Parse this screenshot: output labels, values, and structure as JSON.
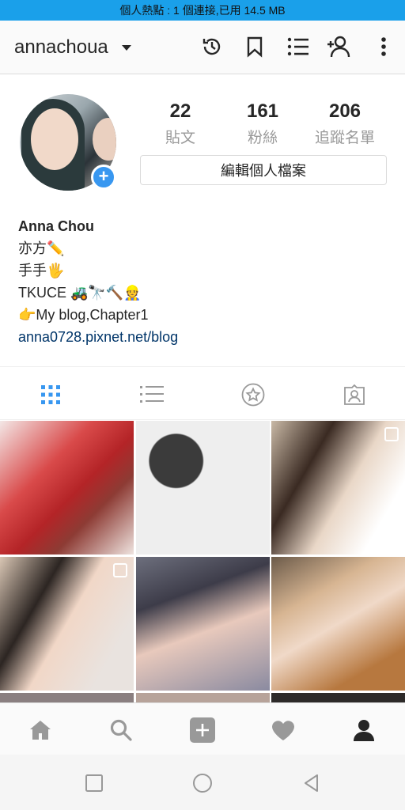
{
  "status_bar": {
    "text": "個人熱點 : 1 個連接,已用 14.5 MB"
  },
  "header": {
    "username": "annachoua"
  },
  "stats": [
    {
      "value": "22",
      "label": "貼文"
    },
    {
      "value": "161",
      "label": "粉絲"
    },
    {
      "value": "206",
      "label": "追蹤名單"
    }
  ],
  "edit_profile_label": "編輯個人檔案",
  "bio": {
    "name": "Anna Chou",
    "lines": [
      "亦方✏️",
      "手手🖐",
      "TKUCE 🚜🔭🔨👷",
      "👉My blog,Chapter1"
    ],
    "link": "anna0728.pixnet.net/blog"
  },
  "colors": {
    "accent": "#3897f0",
    "status_bar": "#1aa0ea",
    "link": "#003569",
    "muted": "#999999"
  },
  "grid": [
    {
      "bg": "linear-gradient(135deg,#f3e7e6 0%,#d94a4a 35%,#b42427 55%,#8d3b34 70%,#efe4e0 100%)",
      "multi": false
    },
    {
      "bg": "radial-gradient(circle at 30% 30%,#3b3b3b 0 20%,#eee 21% 100%)",
      "multi": false
    },
    {
      "bg": "linear-gradient(120deg,#c9b9a6 0%,#3a2a22 30%,#e9d7c7 55%,#ffffff 80%)",
      "multi": true
    },
    {
      "bg": "linear-gradient(120deg,#d9c6b4 0%,#2c2522 30%,#f1d7c7 50%,#e9e3df 80%)",
      "multi": true
    },
    {
      "bg": "linear-gradient(160deg,#6d6f7d 0%,#3d3c49 30%,#e8c9bc 55%,#8a8aa0 100%)",
      "multi": false
    },
    {
      "bg": "linear-gradient(150deg,#6b5a49 0%,#d7b592 30%,#f0d9c8 50%,#b7783f 80%)",
      "multi": false
    }
  ],
  "icons": {
    "header": [
      "history-icon",
      "bookmark-icon",
      "list-icon",
      "add-person-icon",
      "more-icon"
    ],
    "tabs": [
      "grid-icon",
      "list-view-icon",
      "star-icon",
      "tagged-icon"
    ],
    "nav": [
      "home-icon",
      "search-icon",
      "add-post-icon",
      "heart-icon",
      "profile-icon"
    ],
    "system": [
      "recent-apps-icon",
      "home-circle-icon",
      "back-icon"
    ]
  }
}
